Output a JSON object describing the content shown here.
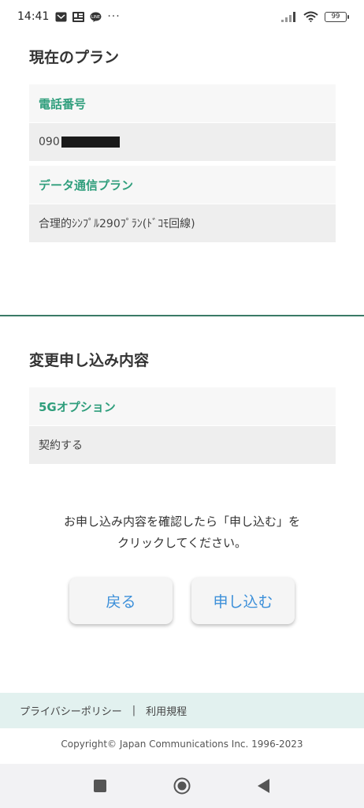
{
  "status_bar": {
    "time": "14:41",
    "dots": "···",
    "battery": "99",
    "icons": [
      "mail-app-icon",
      "news-app-icon",
      "line-app-icon",
      "signal-icon",
      "wifi-icon",
      "battery-icon"
    ]
  },
  "current_plan": {
    "title": "現在のプラン",
    "phone_label": "電話番号",
    "phone_value": "090",
    "plan_label": "データ通信プラン",
    "plan_value": "合理的ｼﾝﾌﾟﾙ290ﾌﾟﾗﾝ(ﾄﾞｺﾓ回線)"
  },
  "change_request": {
    "title": "変更申し込み内容",
    "option_label": "5Gオプション",
    "option_value": "契約する"
  },
  "confirm": {
    "line1": "お申し込み内容を確認したら「申し込む」を",
    "line2": "クリックしてください。"
  },
  "buttons": {
    "back": "戻る",
    "apply": "申し込む"
  },
  "footer": {
    "privacy": "プライバシーポリシー",
    "separator": "|",
    "terms": "利用規程",
    "copyright": "Copyright© Japan Communications Inc. 1996-2023"
  },
  "colors": {
    "accent_green": "#2f9e7c",
    "button_text": "#3b8fd9",
    "footer_bg": "#e2f1ef",
    "divider": "#3a7a66"
  }
}
